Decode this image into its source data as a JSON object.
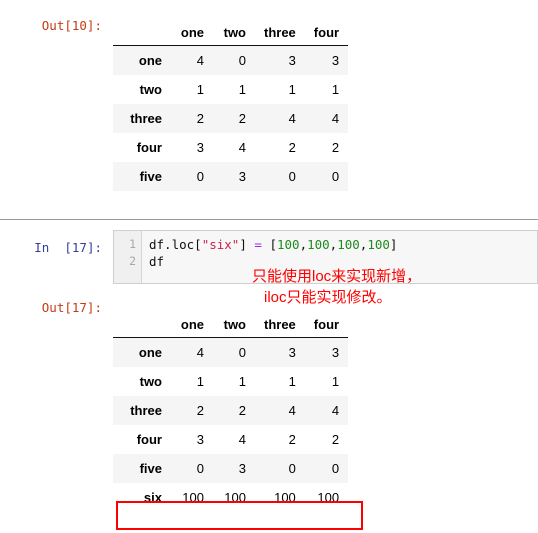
{
  "notebook": {
    "cells": [
      {
        "kind": "output",
        "prompt": "Out[10]:"
      },
      {
        "kind": "input",
        "prompt": "In  [17]:",
        "line_numbers": [
          "1",
          "2"
        ]
      },
      {
        "kind": "output",
        "prompt": "Out[17]:"
      }
    ]
  },
  "code": {
    "line1": {
      "name": "df.loc[",
      "string": "\"six\"",
      "close": "]",
      "op": "=",
      "open_list": "[",
      "n1": "100",
      "c1": ",",
      "n2": "100",
      "c2": ",",
      "n3": "100",
      "c3": ",",
      "n4": "100",
      "close_list": "]"
    },
    "line2": {
      "name": "df"
    },
    "full_line1": "df.loc[\"six\"] = [100,100,100,100]",
    "full_line2": "df"
  },
  "annotation": {
    "line1": "只能使用loc来实现新增，",
    "line2": "iloc只能实现修改。",
    "color": "#ff0000"
  },
  "table_before": {
    "index_name": "",
    "columns": [
      "one",
      "two",
      "three",
      "four"
    ],
    "index": [
      "one",
      "two",
      "three",
      "four",
      "five"
    ],
    "rows": [
      [
        "4",
        "0",
        "3",
        "3"
      ],
      [
        "1",
        "1",
        "1",
        "1"
      ],
      [
        "2",
        "2",
        "4",
        "4"
      ],
      [
        "3",
        "4",
        "2",
        "2"
      ],
      [
        "0",
        "3",
        "0",
        "0"
      ]
    ]
  },
  "table_after": {
    "index_name": "",
    "columns": [
      "one",
      "two",
      "three",
      "four"
    ],
    "index": [
      "one",
      "two",
      "three",
      "four",
      "five",
      "six"
    ],
    "rows": [
      [
        "4",
        "0",
        "3",
        "3"
      ],
      [
        "1",
        "1",
        "1",
        "1"
      ],
      [
        "2",
        "2",
        "4",
        "4"
      ],
      [
        "3",
        "4",
        "2",
        "2"
      ],
      [
        "0",
        "3",
        "0",
        "0"
      ],
      [
        "100",
        "100",
        "100",
        "100"
      ]
    ],
    "highlighted_row_index": 5
  },
  "colors": {
    "out_prompt": "#c43a16",
    "in_prompt": "#303f9f",
    "row_stripe": "#f5f5f5",
    "code_bg": "#f7f7f7",
    "highlight": "#ff0000",
    "string_token": "#c7254e",
    "number_token": "#1f8a1f",
    "operator_token": "#aa22ff"
  }
}
